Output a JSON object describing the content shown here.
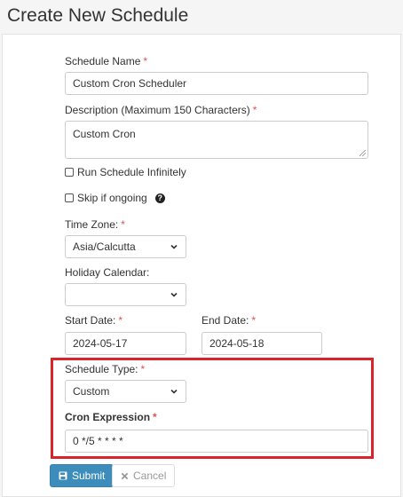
{
  "page_title": "Create New Schedule",
  "form": {
    "schedule_name": {
      "label": "Schedule Name",
      "required_mark": "*",
      "value": "Custom Cron Scheduler"
    },
    "description": {
      "label": "Description (Maximum 150 Characters)",
      "required_mark": "*",
      "value": "Custom Cron"
    },
    "run_infinitely": {
      "label": "Run Schedule Infinitely",
      "checked": false
    },
    "skip_if_ongoing": {
      "label": "Skip if ongoing",
      "checked": false,
      "help_icon": "question-circle-icon"
    },
    "time_zone": {
      "label": "Time Zone:",
      "required_mark": "*",
      "value": "Asia/Calcutta"
    },
    "holiday_calendar": {
      "label": "Holiday Calendar:",
      "value": ""
    },
    "start_date": {
      "label": "Start Date:",
      "required_mark": "*",
      "value": "2024-05-17"
    },
    "end_date": {
      "label": "End Date:",
      "required_mark": "*",
      "value": "2024-05-18"
    },
    "schedule_type": {
      "label": "Schedule Type:",
      "required_mark": "*",
      "value": "Custom"
    },
    "cron_expression": {
      "label": "Cron Expression",
      "required_mark": "*",
      "value": "0 */5 * * * *"
    }
  },
  "actions": {
    "submit_label": "Submit",
    "submit_icon": "save-icon",
    "cancel_label": "Cancel",
    "cancel_icon": "close-icon"
  },
  "colors": {
    "primary": "#3c8dbc",
    "required": "#d9534f",
    "highlight_border": "#d9242a"
  }
}
